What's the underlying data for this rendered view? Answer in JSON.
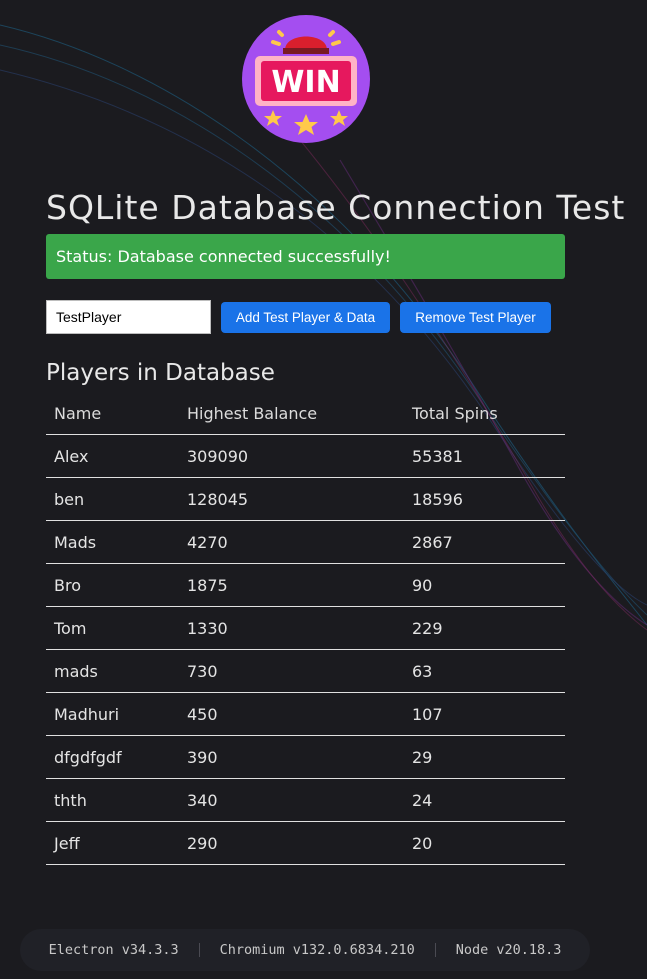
{
  "logo": {
    "text": "WIN"
  },
  "title": "SQLite Database Connection Test",
  "status": "Status: Database connected successfully!",
  "controls": {
    "input_value": "TestPlayer",
    "add_label": "Add Test Player & Data",
    "remove_label": "Remove Test Player"
  },
  "players_heading": "Players in Database",
  "table": {
    "headers": [
      "Name",
      "Highest Balance",
      "Total Spins"
    ],
    "rows": [
      [
        "Alex",
        "309090",
        "55381"
      ],
      [
        "ben",
        "128045",
        "18596"
      ],
      [
        "Mads",
        "4270",
        "2867"
      ],
      [
        "Bro",
        "1875",
        "90"
      ],
      [
        "Tom",
        "1330",
        "229"
      ],
      [
        "mads",
        "730",
        "63"
      ],
      [
        "Madhuri",
        "450",
        "107"
      ],
      [
        "dfgdfgdf",
        "390",
        "29"
      ],
      [
        "thth",
        "340",
        "24"
      ],
      [
        "Jeff",
        "290",
        "20"
      ]
    ]
  },
  "versions": {
    "electron": "Electron v34.3.3",
    "chromium": "Chromium v132.0.6834.210",
    "node": "Node v20.18.3"
  },
  "colors": {
    "background": "#1b1b1f",
    "status_bg": "#3aa64a",
    "button_bg": "#1a73e8",
    "logo_circle": "#a44ef0"
  }
}
